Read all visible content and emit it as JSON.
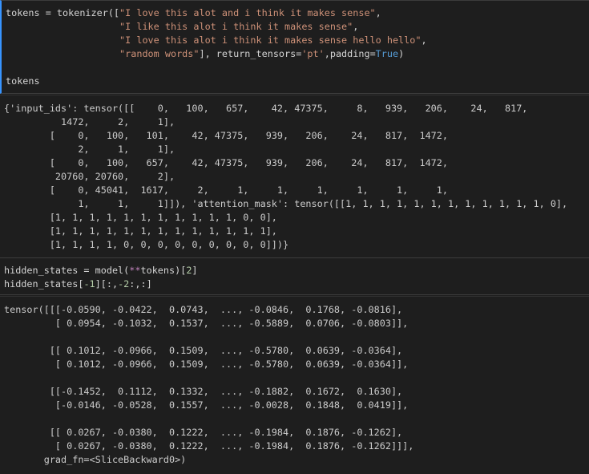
{
  "cells": [
    {
      "type": "code",
      "lines": [
        [
          {
            "t": "tokens = tokenizer([",
            "c": "plain"
          },
          {
            "t": "\"I love this alot and i think it makes sense\"",
            "c": "str"
          },
          {
            "t": ",",
            "c": "plain"
          }
        ],
        [
          {
            "t": "                    ",
            "c": "plain"
          },
          {
            "t": "\"I like this alot i think it makes sense\"",
            "c": "str"
          },
          {
            "t": ",",
            "c": "plain"
          }
        ],
        [
          {
            "t": "                    ",
            "c": "plain"
          },
          {
            "t": "\"I love this alot i think it makes sense hello hello\"",
            "c": "str"
          },
          {
            "t": ",",
            "c": "plain"
          }
        ],
        [
          {
            "t": "                    ",
            "c": "plain"
          },
          {
            "t": "\"random words\"",
            "c": "str"
          },
          {
            "t": "], return_tensors=",
            "c": "plain"
          },
          {
            "t": "'pt'",
            "c": "str"
          },
          {
            "t": ",padding=",
            "c": "plain"
          },
          {
            "t": "True",
            "c": "bool"
          },
          {
            "t": ")",
            "c": "plain"
          }
        ],
        [
          {
            "t": "",
            "c": "plain"
          }
        ],
        [
          {
            "t": "tokens",
            "c": "plain"
          }
        ]
      ]
    },
    {
      "type": "output",
      "lines": [
        "{'input_ids': tensor([[    0,   100,   657,    42, 47375,     8,   939,   206,    24,   817,",
        "          1472,     2,     1],",
        "        [    0,   100,   101,    42, 47375,   939,   206,    24,   817,  1472,",
        "             2,     1,     1],",
        "        [    0,   100,   657,    42, 47375,   939,   206,    24,   817,  1472,",
        "         20760, 20760,     2],",
        "        [    0, 45041,  1617,     2,     1,     1,     1,     1,     1,     1,",
        "             1,     1,     1]]), 'attention_mask': tensor([[1, 1, 1, 1, 1, 1, 1, 1, 1, 1, 1, 1, 0],",
        "        [1, 1, 1, 1, 1, 1, 1, 1, 1, 1, 1, 0, 0],",
        "        [1, 1, 1, 1, 1, 1, 1, 1, 1, 1, 1, 1, 1],",
        "        [1, 1, 1, 1, 0, 0, 0, 0, 0, 0, 0, 0, 0]])}"
      ]
    },
    {
      "type": "code",
      "lines": [
        [
          {
            "t": "hidden_states = model(",
            "c": "plain"
          },
          {
            "t": "**",
            "c": "op"
          },
          {
            "t": "tokens)[",
            "c": "plain"
          },
          {
            "t": "2",
            "c": "num"
          },
          {
            "t": "]",
            "c": "plain"
          }
        ],
        [
          {
            "t": "hidden_states[",
            "c": "plain"
          },
          {
            "t": "-1",
            "c": "num"
          },
          {
            "t": "][:,",
            "c": "plain"
          },
          {
            "t": "-2",
            "c": "num"
          },
          {
            "t": ":,:]",
            "c": "plain"
          }
        ]
      ]
    },
    {
      "type": "output",
      "lines": [
        "tensor([[[-0.0590, -0.0422,  0.0743,  ..., -0.0846,  0.1768, -0.0816],",
        "         [ 0.0954, -0.1032,  0.1537,  ..., -0.5889,  0.0706, -0.0803]],",
        "",
        "        [[ 0.1012, -0.0966,  0.1509,  ..., -0.5780,  0.0639, -0.0364],",
        "         [ 0.1012, -0.0966,  0.1509,  ..., -0.5780,  0.0639, -0.0364]],",
        "",
        "        [[-0.1452,  0.1112,  0.1332,  ..., -0.1882,  0.1672,  0.1630],",
        "         [-0.0146, -0.0528,  0.1557,  ..., -0.0028,  0.1848,  0.0419]],",
        "",
        "        [[ 0.0267, -0.0380,  0.1222,  ..., -0.1984,  0.1876, -0.1262],",
        "         [ 0.0267, -0.0380,  0.1222,  ..., -0.1984,  0.1876, -0.1262]]],",
        "       grad_fn=<SliceBackward0>)"
      ]
    }
  ]
}
